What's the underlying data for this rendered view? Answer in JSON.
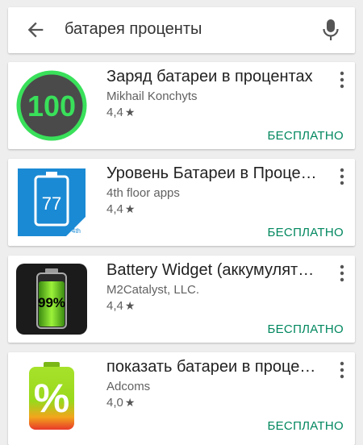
{
  "search": {
    "query": "батарея проценты",
    "back_icon": "arrow-back-icon",
    "mic_icon": "microphone-icon"
  },
  "apps": [
    {
      "title": "Заряд батареи в процентах",
      "developer": "Mikhail Konchyts",
      "rating": "4,4",
      "price": "БЕСПЛАТНО",
      "icon": {
        "name": "battery-percent-100-icon",
        "label": "100",
        "accent": "#39e05a"
      }
    },
    {
      "title": "Уровень Батареи в Проце…",
      "developer": "4th floor apps",
      "rating": "4,4",
      "price": "БЕСПЛАТНО",
      "icon": {
        "name": "battery-level-77-icon",
        "label": "77",
        "accent": "#1a8ad4"
      }
    },
    {
      "title": "Battery Widget (аккумулят…",
      "developer": "M2Catalyst, LLC.",
      "rating": "4,4",
      "price": "БЕСПЛАТНО",
      "icon": {
        "name": "battery-widget-99-icon",
        "label": "99%",
        "accent": "#7ee21f"
      }
    },
    {
      "title": "показать батареи в проце…",
      "developer": "Adcoms",
      "rating": "4,0",
      "price": "БЕСПЛАТНО",
      "icon": {
        "name": "battery-percent-sign-icon",
        "label": "%",
        "accent": "#8cd21c"
      }
    }
  ],
  "colors": {
    "background": "#eeeeee",
    "card": "#ffffff",
    "price_green": "#01875f",
    "text_primary": "#222222",
    "text_secondary": "#616161"
  }
}
